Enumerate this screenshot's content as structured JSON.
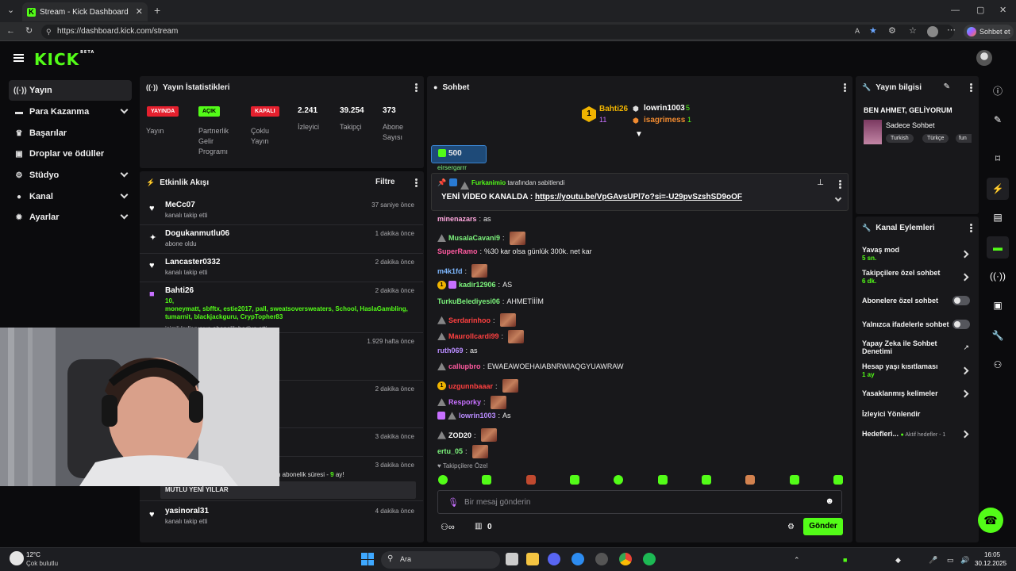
{
  "browser": {
    "tab_title": "Stream - Kick Dashboard",
    "url": "https://dashboard.kick.com/stream",
    "profile_label": "Sohbet et",
    "new_tab": "+"
  },
  "brand": {
    "logo": "KICK",
    "beta": "BETA",
    "accent": "#53fc18"
  },
  "sidebar": {
    "items": [
      {
        "label": "Yayın",
        "icon": "broadcast-icon",
        "active": true,
        "expandable": false
      },
      {
        "label": "Para Kazanma",
        "icon": "money-icon",
        "expandable": true
      },
      {
        "label": "Başarılar",
        "icon": "trophy-icon",
        "expandable": false
      },
      {
        "label": "Droplar ve ödüller",
        "icon": "gift-icon",
        "expandable": false
      },
      {
        "label": "Stüdyo",
        "icon": "studio-icon",
        "expandable": true
      },
      {
        "label": "Kanal",
        "icon": "user-icon",
        "expandable": true
      },
      {
        "label": "Ayarlar",
        "icon": "gear-icon",
        "expandable": true
      }
    ]
  },
  "stats": {
    "title": "Yayın İstatistikleri",
    "items": [
      {
        "badge": "YAYINDA",
        "badge_color": "#e5202e",
        "label": "Yayın"
      },
      {
        "badge": "AÇIK",
        "badge_color": "#53fc18",
        "label": "Partnerlik Gelir Programı"
      },
      {
        "badge": "KAPALI",
        "badge_color": "#e5202e",
        "label": "Çoklu Yayın"
      },
      {
        "value": "2.241",
        "label": "İzleyici"
      },
      {
        "value": "39.254",
        "label": "Takipçi"
      },
      {
        "value": "373",
        "label": "Abone Sayısı"
      }
    ]
  },
  "activity": {
    "title": "Etkinlik Akışı",
    "filter": "Filtre",
    "items": [
      {
        "name": "MeCc07",
        "sub": "kanalı takip etti",
        "time": "37 saniye önce",
        "icon": "heart-icon"
      },
      {
        "name": "Dogukanmutlu06",
        "sub": "abone oldu",
        "time": "1 dakika önce",
        "icon": "sparkle-icon"
      },
      {
        "name": "Lancaster0332",
        "sub": "kanalı takip etti",
        "time": "2 dakika önce",
        "icon": "heart-icon"
      },
      {
        "name": "Bahti26",
        "gift_count": "10,",
        "gift_list": "moneymatt, sbfftx, estie2017, pall, sweatsoversweaters, School, HaslaGambling, tumarnit, blackjackguru, CrypTopher83",
        "sub": "isimli kullanıcıya abonelik hediye etti.",
        "time": "2 dakika önce",
        "icon": "gift-icon"
      },
      {
        "time": "1.929 hafta önce"
      },
      {
        "time": "2 dakika önce"
      },
      {
        "time": "3 dakika önce"
      },
      {
        "time": "3 dakika önce",
        "sub_text": "n abonelik süresi - ",
        "months": "9",
        "months_suffix": " ay!",
        "message": "MUTLU YENİ YILLAR"
      },
      {
        "name": "yasinoral31",
        "sub": "kanalı takip etti",
        "time": "4 dakika önce",
        "icon": "heart-icon"
      }
    ]
  },
  "chat": {
    "title": "Sohbet",
    "leaderboard": {
      "first": {
        "name": "Bahti26",
        "count": "11"
      },
      "others": [
        {
          "name": "lowrin1003",
          "count": "5"
        },
        {
          "name": "isagrimess",
          "count": "1"
        }
      ]
    },
    "pinned_amount": "500",
    "pinned": {
      "by": "Furkanimio",
      "by_suffix": "tarafından sabitlendi",
      "text": "YENİ VİDEO KANALDA : ",
      "link": "https://youtu.be/VpGAvsUPl7o?si=-U29pvSzshSD9oOF"
    },
    "partial_top": "eirsergarrr",
    "messages": [
      {
        "user": "minenazars",
        "color": "#ffa7dd",
        "text": "as"
      },
      {
        "user": "MusalaCavani9",
        "color": "#7cf37c",
        "text": "",
        "emote": true,
        "mod": true
      },
      {
        "user": "SuperRamo",
        "color": "#ff5aa0",
        "text": "%30 kar olsa günlük 300k. net kar"
      },
      {
        "user": "m4k1fd",
        "color": "#7eb8ff",
        "text": "",
        "emote": true
      },
      {
        "user": "kadir12906",
        "color": "#7cf37c",
        "text": "AS",
        "sub": true,
        "gift": true
      },
      {
        "user": "TurkuBelediyesi06",
        "color": "#7cf37c",
        "text": "AHMETİİİM"
      },
      {
        "user": "Serdarinhoo",
        "color": "#ff4040",
        "text": "",
        "emote": true,
        "mod": true
      },
      {
        "user": "Maurollcardi99",
        "color": "#ff4040",
        "text": "",
        "emote": true,
        "mod": true
      },
      {
        "user": "ruth069",
        "color": "#b98cff",
        "text": "as"
      },
      {
        "user": "callupbro",
        "color": "#ff5aa0",
        "text": "EWAEAWOEHAIABNRWIAQGYUAWRAW",
        "mod": true
      },
      {
        "user": "uzgunnbaaar",
        "color": "#ff4040",
        "text": "",
        "emote": true,
        "sub": true
      },
      {
        "user": "Resporky",
        "color": "#c770ff",
        "text": "",
        "emote": true,
        "mod": true
      },
      {
        "user": "lowrin1003",
        "color": "#b98cff",
        "text": "As",
        "mod": true,
        "gift": true
      },
      {
        "user": "ZOD20",
        "color": "#ffffff",
        "text": "",
        "emote": true,
        "mod": true
      },
      {
        "user": "ertu_05",
        "color": "#7cf37c",
        "text": "",
        "emote": true
      }
    ],
    "followers_only": "Takipçilere Özel",
    "input_placeholder": "Bir mesaj gönderin",
    "send": "Gönder",
    "points": "0"
  },
  "info": {
    "title": "Yayın bilgisi",
    "stream_title": "BEN AHMET, GELİYORUM",
    "category": "Sadece Sohbet",
    "tags": [
      "Turkish",
      "Türkçe",
      "fun"
    ]
  },
  "actions": {
    "title": "Kanal Eylemleri",
    "items": [
      {
        "label": "Yavaş mod",
        "sub": "5 sn.",
        "type": "chevron"
      },
      {
        "label": "Takipçilere özel sohbet",
        "sub": "6 dk.",
        "type": "chevron"
      },
      {
        "label": "Abonelere özel sohbet",
        "type": "toggle"
      },
      {
        "label": "Yalnızca ifadelerle sohbet",
        "type": "toggle"
      },
      {
        "label": "Yapay Zeka ile Sohbet Denetimi",
        "type": "external"
      },
      {
        "label": "Hesap yaşı kısıtlaması",
        "sub": "1 ay",
        "type": "chevron"
      },
      {
        "label": "Yasaklanmış kelimeler",
        "type": "chevron"
      },
      {
        "label": "İzleyici Yönlendir",
        "type": "none"
      },
      {
        "label": "Hedefleri...",
        "sub": "Aktif hedefler - 1",
        "type": "chevron"
      }
    ]
  },
  "taskbar": {
    "weather_temp": "12°C",
    "weather_desc": "Çok bulutlu",
    "search": "Ara",
    "time": "16:05",
    "date": "30.12.2025"
  }
}
